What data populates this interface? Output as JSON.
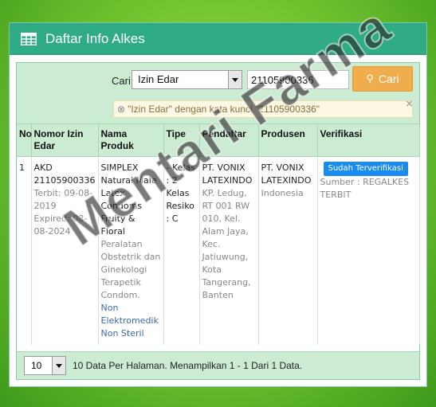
{
  "panel": {
    "title": "Daftar Info Alkes",
    "icon": "table-icon"
  },
  "search": {
    "label": "Cari",
    "type_selected": "Izin Edar",
    "keyword": "21105900336",
    "button_label": "Cari",
    "filter_text": "\"Izin Edar\" dengan kata kunci \"21105900336\""
  },
  "table": {
    "headers": [
      "No",
      "Nomor Izin Edar",
      "Nama Produk",
      "Tipe",
      "Pendaftar",
      "Produsen",
      "Verifikasi"
    ],
    "rows": [
      {
        "no": "1",
        "nomor": {
          "jenis": "AKD",
          "nomor": "21105900336",
          "terbit": "Terbit: 09-08-2019",
          "expired": "Expired: 08-08-2024"
        },
        "produk": {
          "nama": "SIMPLEX Natural Male Latex Condoms Fruity & Floral",
          "kategori": "Peralatan Obstetrik dan Ginekologi Terapetik Condom.",
          "jenis": "Non Elektromedik Non Steril"
        },
        "tipe": "- Kelas : 2 Kelas Resiko : C",
        "pendaftar": {
          "nama": "PT. VONIX LATEXINDO",
          "alamat": "KP. Ledug, RT 001 RW 010, Kel. Alam Jaya, Kec. Jatiuwung, Kota Tangerang, Banten"
        },
        "produsen": {
          "nama": "PT. VONIX LATEXINDO",
          "negara": "Indonesia"
        },
        "verifikasi": {
          "badge": "Sudah Terverifikasi",
          "sumber": "Sumber : REGALKES TERBIT"
        }
      }
    ]
  },
  "footer": {
    "per_page": "10",
    "text": "10 Data Per Halaman. Menampilkan 1 - 1 Dari 1 Data."
  },
  "watermark": "Mentari Farma",
  "colors": {
    "header_green": "#2fab86",
    "light_green": "#ccebd3",
    "button_orange": "#f0ad4e",
    "badge_blue": "#1a8cf0"
  }
}
